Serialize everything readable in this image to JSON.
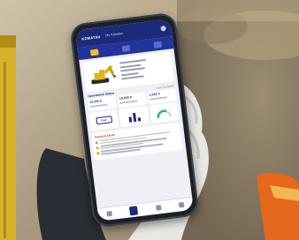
{
  "app": {
    "brand": "KOMATSU",
    "context": "My Komatsu"
  },
  "machine": {
    "icon": "excavator-icon"
  },
  "operational_status": {
    "title": "Operational Status",
    "updated": "Last Updated",
    "stats": [
      "12,205 h",
      "14,000 h",
      "2,342 h"
    ]
  },
  "fuel": {
    "label": "Fuel"
  },
  "alerts": {
    "title": "General Alerts"
  },
  "colors": {
    "brand_navy": "#1b2a7a",
    "accent_yellow": "#f2c21b",
    "alert_red": "#c6371c"
  }
}
